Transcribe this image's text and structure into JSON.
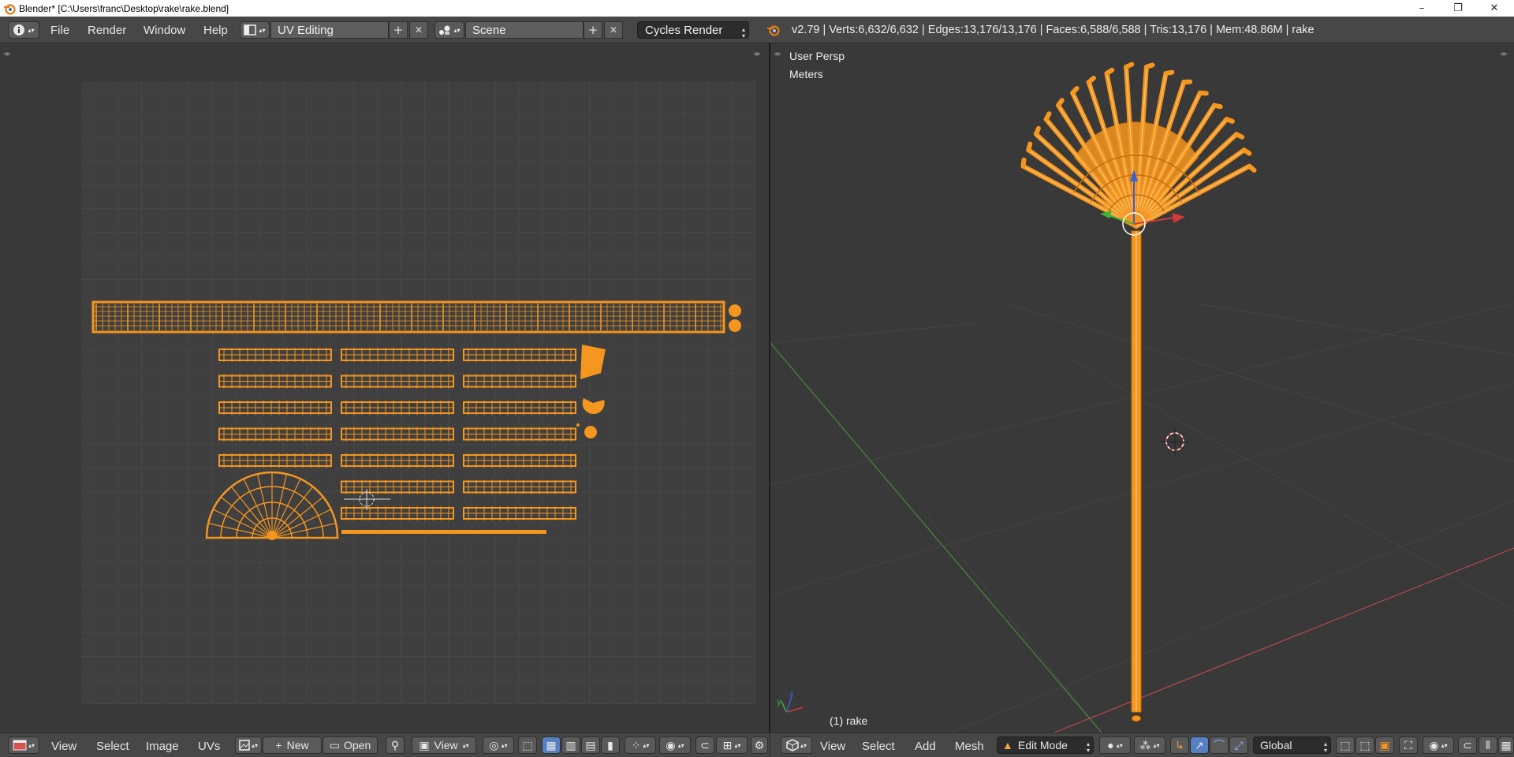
{
  "window": {
    "title": "Blender* [C:\\Users\\franc\\Desktop\\rake\\rake.blend]",
    "minimize_glyph": "–",
    "maximize_glyph": "❐",
    "close_glyph": "✕"
  },
  "info_header": {
    "menus": [
      "File",
      "Render",
      "Window",
      "Help"
    ],
    "screen_layout": "UV Editing",
    "scene": "Scene",
    "render_engine": "Cycles Render",
    "stats": "v2.79 | Verts:6,632/6,632 | Edges:13,176/13,176 | Faces:6,588/6,588 | Tris:13,176 | Mem:48.86M | rake",
    "add_glyph": "+",
    "remove_glyph": "✕"
  },
  "viewport": {
    "view_name": "User Persp",
    "units": "Meters",
    "object_label": "(1) rake"
  },
  "uv_footer": {
    "menus": [
      "View",
      "Select",
      "Image",
      "UVs"
    ],
    "new_label": "New",
    "open_label": "Open",
    "view_label": "View"
  },
  "view3d_footer": {
    "menus": [
      "View",
      "Select",
      "Add",
      "Mesh"
    ],
    "mode": "Edit Mode",
    "orientation": "Global"
  },
  "colors": {
    "mesh_orange": "#f5961e",
    "grid_bg": "#3f3f3f",
    "header_bg": "#474747",
    "axis_red": "#b54a4a",
    "axis_green": "#4a8a3a",
    "accent_blue": "#5680c2"
  },
  "icons": [
    "blender-logo-icon",
    "info-editor-icon",
    "screen-layout-icon",
    "scene-icon",
    "blender-engine-icon",
    "uv-editor-type-icon",
    "image-browse-icon",
    "pin-icon",
    "view3d-editor-type-icon",
    "shading-solid-icon",
    "pivot-icon",
    "manipulator-icon",
    "translate-icon",
    "rotate-icon",
    "scale-icon",
    "proportional-edit-icon",
    "snap-icon",
    "layers-icon"
  ]
}
